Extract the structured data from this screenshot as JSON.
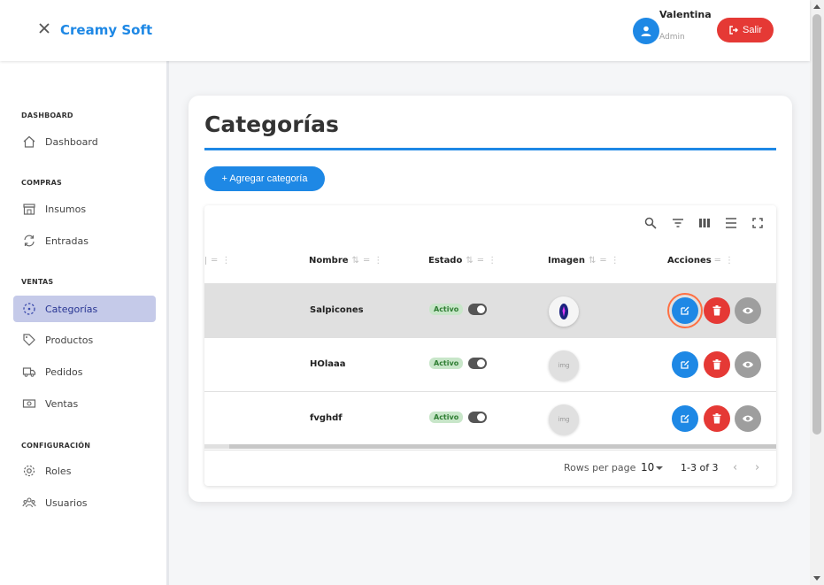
{
  "header": {
    "brand": "Creamy Soft",
    "user_name": "Valentina",
    "user_role": "Admin",
    "logout_label": "Salir"
  },
  "sidebar": {
    "sections": [
      {
        "title": "DASHBOARD",
        "items": [
          {
            "label": "Dashboard",
            "icon": "home-icon"
          }
        ]
      },
      {
        "title": "COMPRAS",
        "items": [
          {
            "label": "Insumos",
            "icon": "store-icon"
          },
          {
            "label": "Entradas",
            "icon": "refresh-icon"
          }
        ]
      },
      {
        "title": "VENTAS",
        "items": [
          {
            "label": "Categorías",
            "icon": "category-icon",
            "active": true
          },
          {
            "label": "Productos",
            "icon": "tag-icon"
          },
          {
            "label": "Pedidos",
            "icon": "truck-icon"
          },
          {
            "label": "Ventas",
            "icon": "money-icon"
          }
        ]
      },
      {
        "title": "CONFIGURACIÓN",
        "items": [
          {
            "label": "Roles",
            "icon": "gear-icon"
          },
          {
            "label": "Usuarios",
            "icon": "users-icon"
          }
        ]
      }
    ]
  },
  "main": {
    "title": "Categorías",
    "add_button": "+ Agregar categoría",
    "columns": [
      "Nombre",
      "Estado",
      "Imagen",
      "Acciones"
    ],
    "rows": [
      {
        "name": "Salpicones",
        "status": "Activo",
        "has_image": true
      },
      {
        "name": "HOlaaa",
        "status": "Activo",
        "has_image": false
      },
      {
        "name": "fvghdf",
        "status": "Activo",
        "has_image": false
      }
    ],
    "broken_image_text": "img",
    "pagination": {
      "rows_per_page_label": "Rows per page",
      "rows_per_page_value": "10",
      "range": "1-3 of 3"
    }
  },
  "colors": {
    "accent": "#1e88e5",
    "danger": "#e53935",
    "neutral": "#9e9e9e",
    "active_nav": "#c5cae9",
    "status_bg": "#c8e6c9"
  }
}
